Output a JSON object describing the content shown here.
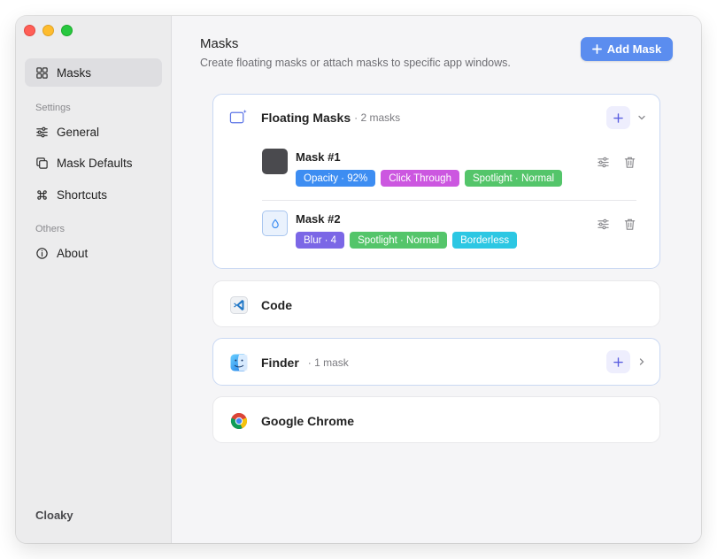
{
  "sidebar": {
    "items": [
      {
        "label": "Masks",
        "icon": "grid-icon"
      },
      {
        "label": "General",
        "icon": "sliders-icon"
      },
      {
        "label": "Mask Defaults",
        "icon": "copy-icon"
      },
      {
        "label": "Shortcuts",
        "icon": "command-icon"
      },
      {
        "label": "About",
        "icon": "info-icon"
      }
    ],
    "sections": {
      "settings": "Settings",
      "others": "Others"
    },
    "app_name": "Cloaky"
  },
  "header": {
    "title": "Masks",
    "subtitle": "Create floating masks or attach masks to specific app windows.",
    "add_button": "Add Mask"
  },
  "groups": [
    {
      "title": "Floating Masks",
      "count": "· 2 masks",
      "icon": "floating-mask-icon",
      "masks": [
        {
          "name": "Mask #1",
          "thumb_color": "#4a4a4e",
          "tags": [
            {
              "label": "Opacity · 92%",
              "color": "#3d8df2"
            },
            {
              "label": "Click Through",
              "color": "#cc57e0"
            },
            {
              "label": "Spotlight · Normal",
              "color": "#54c56a"
            }
          ]
        },
        {
          "name": "Mask #2",
          "thumb_color": "#eaf2fd",
          "tags": [
            {
              "label": "Blur · 4",
              "color": "#7b67e6"
            },
            {
              "label": "Spotlight · Normal",
              "color": "#54c56a"
            },
            {
              "label": "Borderless",
              "color": "#2cc7e3"
            }
          ]
        }
      ]
    },
    {
      "title": "Code",
      "count": "",
      "icon": "vscode-icon"
    },
    {
      "title": "Finder",
      "count": "· 1 mask",
      "icon": "finder-icon"
    },
    {
      "title": "Google Chrome",
      "count": "",
      "icon": "chrome-icon"
    }
  ],
  "colors": {
    "accent": "#5b8def",
    "sidebar_bg": "#ececed",
    "content_bg": "#f5f5f7"
  }
}
